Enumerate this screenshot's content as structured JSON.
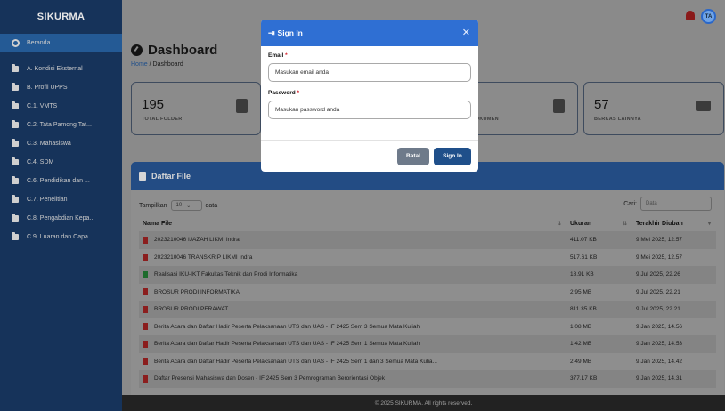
{
  "app": {
    "brand": "SIKURMA",
    "user_initials": "TA"
  },
  "sidebar": {
    "items": [
      {
        "label": "Beranda",
        "icon": "dashboard-icon"
      },
      {
        "label": "A. Kondisi Eksternal",
        "icon": "folder-icon"
      },
      {
        "label": "B. Profil UPPS",
        "icon": "folder-icon"
      },
      {
        "label": "C.1. VMTS",
        "icon": "folder-icon"
      },
      {
        "label": "C.2. Tata Pamong Tat...",
        "icon": "folder-icon"
      },
      {
        "label": "C.3. Mahasiswa",
        "icon": "folder-icon"
      },
      {
        "label": "C.4. SDM",
        "icon": "folder-icon"
      },
      {
        "label": "C.6. Pendidikan dan ...",
        "icon": "folder-icon"
      },
      {
        "label": "C.7. Penelitian",
        "icon": "folder-icon"
      },
      {
        "label": "C.8. Pengabdian Kepa...",
        "icon": "folder-icon"
      },
      {
        "label": "C.9. Luaran dan Capa...",
        "icon": "folder-icon"
      }
    ]
  },
  "header": {
    "title": "Dashboard",
    "breadcrumb_home": "Home",
    "breadcrumb_sep": "/",
    "breadcrumb_current": "Dashboard"
  },
  "stats": {
    "card1": {
      "value": "195",
      "label": "TOTAL FOLDER"
    },
    "card3": {
      "label": "DKUMEN"
    },
    "card4": {
      "value": "57",
      "label": "BERKAS LAINNYA"
    }
  },
  "panel": {
    "title": "Daftar File",
    "show_prefix": "Tampilkan",
    "show_value": "10",
    "show_suffix": "data",
    "search_label": "Cari:",
    "search_placeholder": "Data",
    "columns": {
      "name": "Nama File",
      "size": "Ukuran",
      "modified": "Terakhir Diubah"
    },
    "rows": [
      {
        "name": "2023210046 IJAZAH LIKMI Indra",
        "type": "pdf",
        "size": "411.07 KB",
        "modified": "9 Mei 2025, 12.57"
      },
      {
        "name": "2023210046 TRANSKRIP LIKMI Indra",
        "type": "pdf",
        "size": "517.61 KB",
        "modified": "9 Mei 2025, 12.57"
      },
      {
        "name": "Realisasi IKU-IKT Fakultas Teknik dan Prodi Informatika",
        "type": "xls",
        "size": "18.91 KB",
        "modified": "9 Jul 2025, 22.26"
      },
      {
        "name": "BROSUR PRODI INFORMATIKA",
        "type": "pdf",
        "size": "2.95 MB",
        "modified": "9 Jul 2025, 22.21"
      },
      {
        "name": "BROSUR PRODI PERAWAT",
        "type": "pdf",
        "size": "811.35 KB",
        "modified": "9 Jul 2025, 22.21"
      },
      {
        "name": "Berita Acara dan Daftar Hadir Peserta Pelaksanaan UTS dan UAS - IF 2425 Sem 3 Semua Mata Kuliah",
        "type": "pdf",
        "size": "1.08 MB",
        "modified": "9 Jan 2025, 14.56"
      },
      {
        "name": "Berita Acara dan Daftar Hadir Peserta Pelaksanaan UTS dan UAS - IF 2425 Sem 1 Semua Mata Kuliah",
        "type": "pdf",
        "size": "1.42 MB",
        "modified": "9 Jan 2025, 14.53"
      },
      {
        "name": "Berita Acara dan Daftar Hadir Peserta Pelaksanaan UTS dan UAS - IF 2425 Sem 1 dan 3 Semua Mata Kulia...",
        "type": "pdf",
        "size": "2.49 MB",
        "modified": "9 Jan 2025, 14.42"
      },
      {
        "name": "Daftar Presensi Mahasiswa dan Dosen - IF 2425 Sem 3 Pemrograman Berorientasi Objek",
        "type": "pdf",
        "size": "377.17 KB",
        "modified": "9 Jan 2025, 14.31"
      }
    ]
  },
  "footer": {
    "text": "© 2025 SIKURMA. All rights reserved."
  },
  "modal": {
    "title": "Sign In",
    "close_glyph": "✕",
    "email_label": "Email",
    "email_placeholder": "Masukan email anda",
    "password_label": "Password",
    "password_placeholder": "Masukan password anda",
    "required_mark": "*",
    "cancel_label": "Batal",
    "submit_label": "Sign In"
  },
  "colors": {
    "modal_header": "#2f6fd3",
    "sidebar": "#16335a",
    "panel_header": "#234c84",
    "required": "#d4202b"
  }
}
